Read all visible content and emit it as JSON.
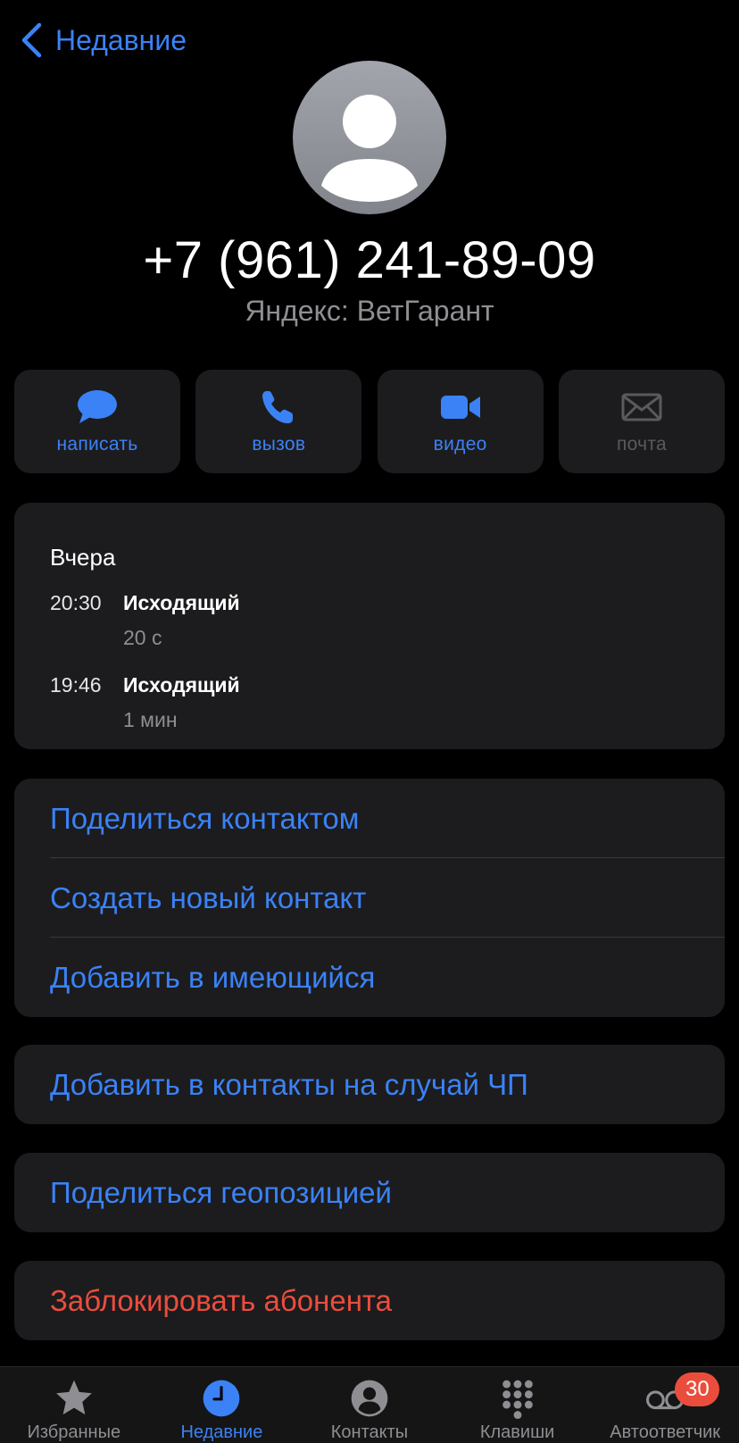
{
  "nav": {
    "back_label": "Недавние"
  },
  "contact": {
    "phone": "+7 (961) 241-89-09",
    "subtitle": "Яндекс: ВетГарант"
  },
  "actions": [
    {
      "label": "написать",
      "icon": "message-bubble-icon",
      "enabled": true
    },
    {
      "label": "вызов",
      "icon": "phone-icon",
      "enabled": true
    },
    {
      "label": "видео",
      "icon": "video-camera-icon",
      "enabled": true
    },
    {
      "label": "почта",
      "icon": "mail-envelope-icon",
      "enabled": false
    }
  ],
  "history": {
    "day": "Вчера",
    "calls": [
      {
        "time": "20:30",
        "type": "Исходящий",
        "duration": "20 с"
      },
      {
        "time": "19:46",
        "type": "Исходящий",
        "duration": "1 мин"
      }
    ]
  },
  "menu_group_1": [
    "Поделиться контактом",
    "Создать новый контакт",
    "Добавить в имеющийся"
  ],
  "emergency_label": "Добавить в контакты на случай ЧП",
  "share_location_label": "Поделиться геопозицией",
  "block_label": "Заблокировать абонента",
  "tabbar": {
    "tabs": [
      {
        "label": "Избранные",
        "icon": "star-icon",
        "active": false
      },
      {
        "label": "Недавние",
        "icon": "clock-icon",
        "active": true
      },
      {
        "label": "Контакты",
        "icon": "person-circle-icon",
        "active": false
      },
      {
        "label": "Клавиши",
        "icon": "keypad-icon",
        "active": false
      },
      {
        "label": "Автоответчик",
        "icon": "voicemail-icon",
        "active": false
      }
    ],
    "voicemail_badge": "30"
  },
  "colors": {
    "accent": "#3b82f6",
    "destructive": "#eb4d3d",
    "card": "#1c1c1e",
    "background": "#000000"
  }
}
